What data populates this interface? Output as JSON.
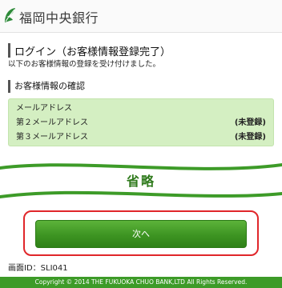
{
  "header": {
    "bank_name": "福岡中央銀行",
    "logo_icon": "leaf-logo-icon"
  },
  "page": {
    "title": "ログイン（お客様情報登録完了）",
    "description": "以下のお客様情報の登録を受け付けました。"
  },
  "section": {
    "title": "お客様情報の確認",
    "rows": [
      {
        "label": "メールアドレス",
        "value": ""
      },
      {
        "label": "第２メールアドレス",
        "value": "(未登録)"
      },
      {
        "label": "第３メールアドレス",
        "value": "(未登録)"
      }
    ]
  },
  "banner": {
    "text": "省略"
  },
  "actions": {
    "next_label": "次へ"
  },
  "screen": {
    "id_label": "画面ID：SLI041"
  },
  "footer": {
    "copyright": "Copyright © 2014 THE FUKUOKA CHUO BANK,LTD All Rights Reserved."
  },
  "colors": {
    "brand_green": "#3d9b28",
    "info_bg": "#d4efc2",
    "focus_red": "#e0262a"
  }
}
